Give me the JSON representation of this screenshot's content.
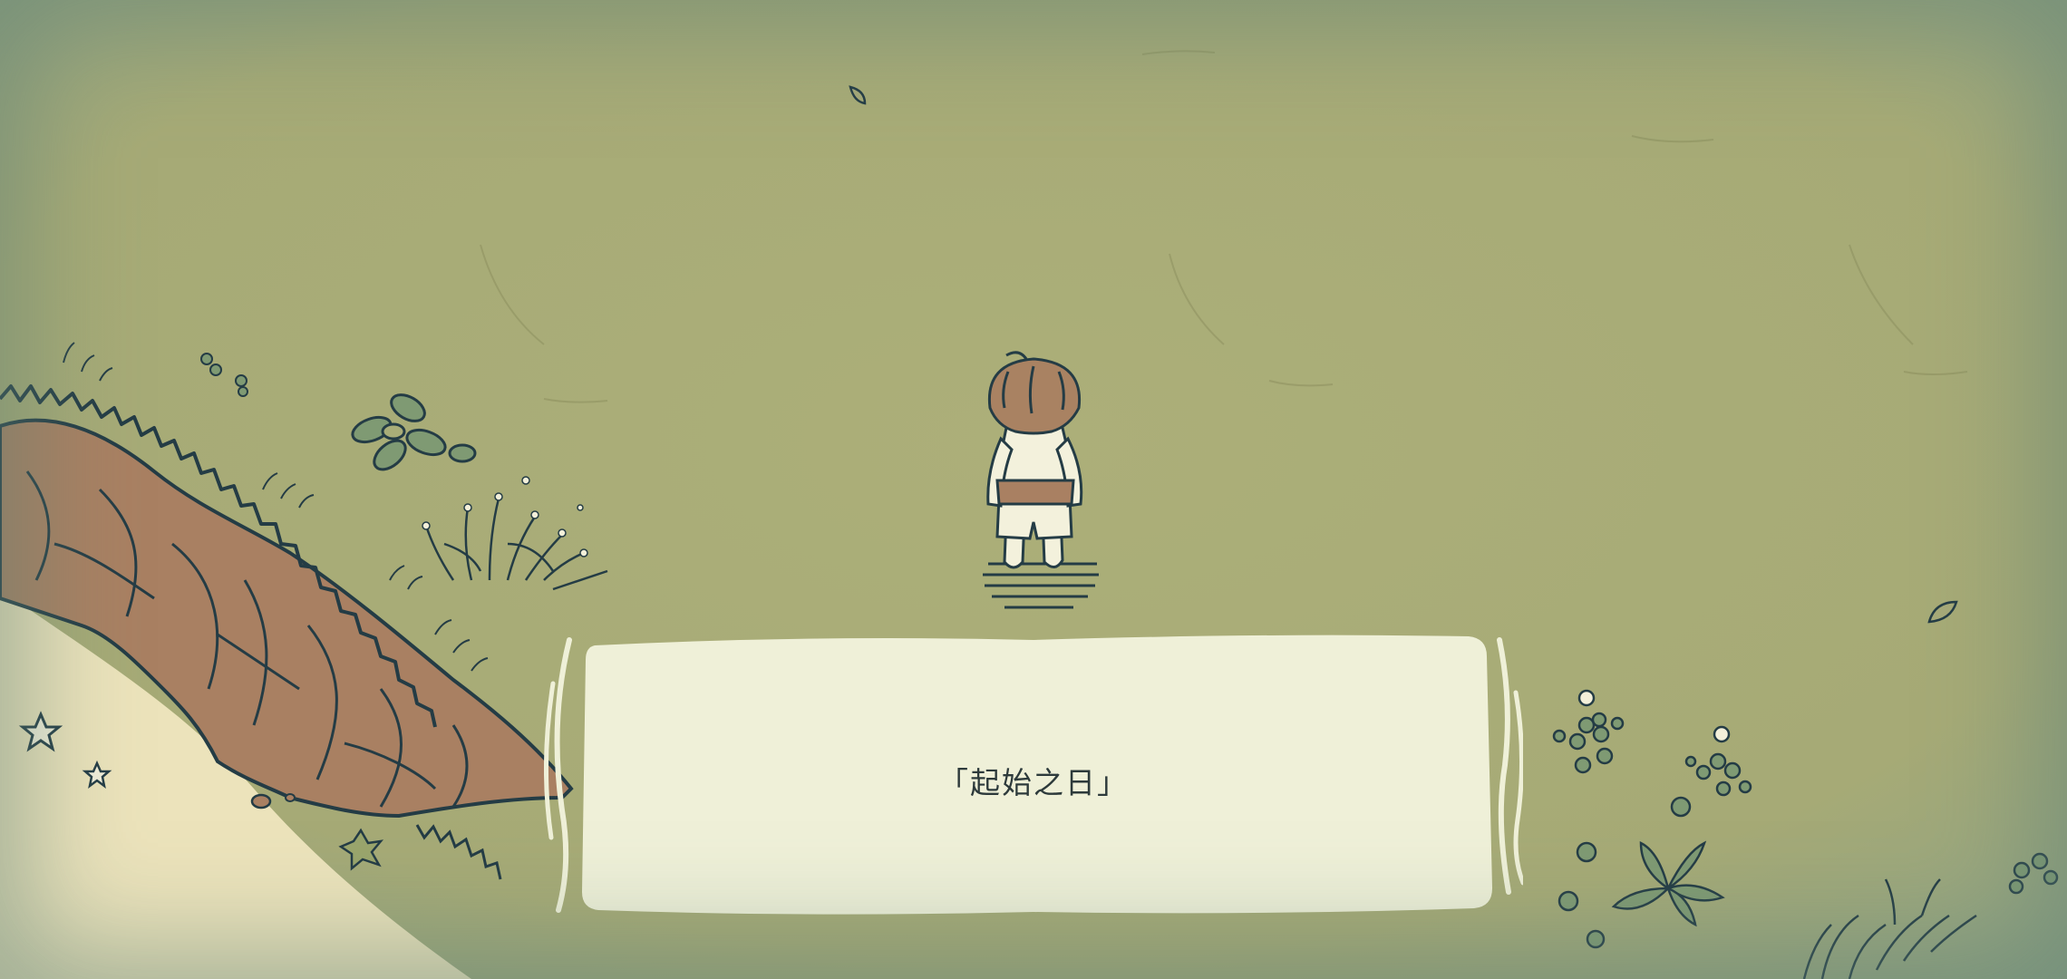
{
  "dialog": {
    "caption": "「起始之日」"
  },
  "colors": {
    "grass": "#a9ad78",
    "grass_edge": "#8fa58a",
    "sand": "#ece3bb",
    "cliff": "#a98062",
    "ink": "#243c45",
    "dialog_fill": "#eff0d8",
    "shirt": "#f3f1dc",
    "hair": "#a98262"
  },
  "icons": {
    "character": "child-back-view",
    "plants": "leafy-plant",
    "flowers": "white-flower",
    "leaf": "falling-leaf",
    "star": "starfish"
  }
}
